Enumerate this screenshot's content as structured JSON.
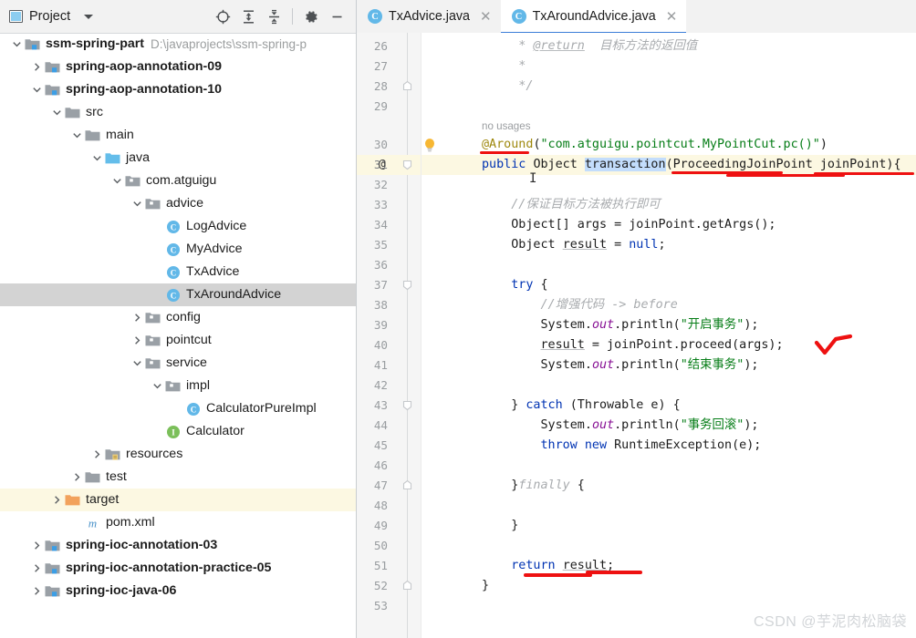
{
  "project_panel": {
    "title": "Project",
    "window_icon": "project-window-icon",
    "dropdown_icon": "chevron-down-icon",
    "toolbar_buttons": [
      {
        "name": "locate-file-icon",
        "label": "Select Opened File"
      },
      {
        "name": "expand-all-icon",
        "label": "Expand All"
      },
      {
        "name": "collapse-all-icon",
        "label": "Collapse All"
      },
      {
        "name": "settings-gear-icon",
        "label": "Options"
      },
      {
        "name": "hide-minimize-icon",
        "label": "Hide"
      }
    ],
    "tree": [
      {
        "label": "ssm-spring-part",
        "path": "D:\\javaprojects\\ssm-spring-p",
        "indent": 0,
        "arrow": "down",
        "icon": "module-folder",
        "bold": true,
        "state": "normal"
      },
      {
        "label": "spring-aop-annotation-09",
        "path": "",
        "indent": 1,
        "arrow": "right",
        "icon": "module-folder",
        "bold": true,
        "state": "normal"
      },
      {
        "label": "spring-aop-annotation-10",
        "path": "",
        "indent": 1,
        "arrow": "down",
        "icon": "module-folder",
        "bold": true,
        "state": "normal"
      },
      {
        "label": "src",
        "path": "",
        "indent": 2,
        "arrow": "down",
        "icon": "folder-gray",
        "bold": false,
        "state": "normal"
      },
      {
        "label": "main",
        "path": "",
        "indent": 3,
        "arrow": "down",
        "icon": "folder-gray",
        "bold": false,
        "state": "normal"
      },
      {
        "label": "java",
        "path": "",
        "indent": 4,
        "arrow": "down",
        "icon": "folder-source",
        "bold": false,
        "state": "normal"
      },
      {
        "label": "com.atguigu",
        "path": "",
        "indent": 5,
        "arrow": "down",
        "icon": "package",
        "bold": false,
        "state": "normal"
      },
      {
        "label": "advice",
        "path": "",
        "indent": 6,
        "arrow": "down",
        "icon": "package",
        "bold": false,
        "state": "normal"
      },
      {
        "label": "LogAdvice",
        "path": "",
        "indent": 7,
        "arrow": "none",
        "icon": "class",
        "bold": false,
        "state": "normal"
      },
      {
        "label": "MyAdvice",
        "path": "",
        "indent": 7,
        "arrow": "none",
        "icon": "class",
        "bold": false,
        "state": "normal"
      },
      {
        "label": "TxAdvice",
        "path": "",
        "indent": 7,
        "arrow": "none",
        "icon": "class",
        "bold": false,
        "state": "normal"
      },
      {
        "label": "TxAroundAdvice",
        "path": "",
        "indent": 7,
        "arrow": "none",
        "icon": "class",
        "bold": false,
        "state": "selected"
      },
      {
        "label": "config",
        "path": "",
        "indent": 6,
        "arrow": "right",
        "icon": "package",
        "bold": false,
        "state": "normal"
      },
      {
        "label": "pointcut",
        "path": "",
        "indent": 6,
        "arrow": "right",
        "icon": "package",
        "bold": false,
        "state": "normal"
      },
      {
        "label": "service",
        "path": "",
        "indent": 6,
        "arrow": "down",
        "icon": "package",
        "bold": false,
        "state": "normal"
      },
      {
        "label": "impl",
        "path": "",
        "indent": 7,
        "arrow": "down",
        "icon": "package",
        "bold": false,
        "state": "normal"
      },
      {
        "label": "CalculatorPureImpl",
        "path": "",
        "indent": 8,
        "arrow": "none",
        "icon": "class",
        "bold": false,
        "state": "normal"
      },
      {
        "label": "Calculator",
        "path": "",
        "indent": 7,
        "arrow": "none",
        "icon": "interface",
        "bold": false,
        "state": "normal"
      },
      {
        "label": "resources",
        "path": "",
        "indent": 4,
        "arrow": "right",
        "icon": "folder-resources",
        "bold": false,
        "state": "normal"
      },
      {
        "label": "test",
        "path": "",
        "indent": 3,
        "arrow": "right",
        "icon": "folder-gray",
        "bold": false,
        "state": "normal"
      },
      {
        "label": "target",
        "path": "",
        "indent": 2,
        "arrow": "right",
        "icon": "folder-target",
        "bold": false,
        "state": "highlighted"
      },
      {
        "label": "pom.xml",
        "path": "",
        "indent": 3,
        "arrow": "none",
        "icon": "maven",
        "bold": false,
        "state": "normal"
      },
      {
        "label": "spring-ioc-annotation-03",
        "path": "",
        "indent": 1,
        "arrow": "right",
        "icon": "module-folder",
        "bold": true,
        "state": "normal"
      },
      {
        "label": "spring-ioc-annotation-practice-05",
        "path": "",
        "indent": 1,
        "arrow": "right",
        "icon": "module-folder",
        "bold": true,
        "state": "normal"
      },
      {
        "label": "spring-ioc-java-06",
        "path": "",
        "indent": 1,
        "arrow": "right",
        "icon": "module-folder",
        "bold": true,
        "state": "normal"
      }
    ]
  },
  "editor": {
    "tabs": [
      {
        "label": "TxAdvice.java",
        "icon": "class",
        "active": false,
        "close_icon": "close-icon"
      },
      {
        "label": "TxAroundAdvice.java",
        "icon": "class",
        "active": true,
        "close_icon": "close-icon"
      }
    ],
    "current_line": 31,
    "gutter_marker_line": 31,
    "gutter_marker": "@",
    "inlay_hint": "no usages",
    "caret_symbol": "I",
    "line_numbers": [
      26,
      27,
      28,
      29,
      30,
      31,
      32,
      33,
      34,
      35,
      36,
      37,
      38,
      39,
      40,
      41,
      42,
      43,
      44,
      45,
      46,
      47,
      48,
      49,
      50,
      51,
      52,
      53
    ],
    "code_lines": [
      {
        "num": 26,
        "tokens": [
          {
            "t": "     * ",
            "c": "doc"
          },
          {
            "t": "@return",
            "c": "doc uline"
          },
          {
            "t": "  目标方法的返回值",
            "c": "doc"
          }
        ]
      },
      {
        "num": 27,
        "tokens": [
          {
            "t": "     *",
            "c": "doc"
          }
        ]
      },
      {
        "num": 28,
        "tokens": [
          {
            "t": "     */",
            "c": "doc"
          }
        ]
      },
      {
        "num": 29,
        "tokens": []
      },
      {
        "num": 30,
        "tokens": [
          {
            "t": "@Around",
            "c": "ann"
          },
          {
            "t": "(",
            "c": "id"
          },
          {
            "t": "\"com.atguigu.pointcut.MyPointCut.pc()\"",
            "c": "str"
          },
          {
            "t": ")",
            "c": "id"
          }
        ]
      },
      {
        "num": 31,
        "tokens": [
          {
            "t": "public ",
            "c": "kw"
          },
          {
            "t": "Object ",
            "c": "id"
          },
          {
            "t": "transaction",
            "c": "id sel-tok"
          },
          {
            "t": "(ProceedingJoinPoint joinPoint){",
            "c": "id"
          }
        ]
      },
      {
        "num": 32,
        "tokens": []
      },
      {
        "num": 33,
        "tokens": [
          {
            "t": "    //保证目标方法被执行即可",
            "c": "cmt"
          }
        ]
      },
      {
        "num": 34,
        "tokens": [
          {
            "t": "    Object[] args = joinPoint.getArgs();",
            "c": "id"
          }
        ]
      },
      {
        "num": 35,
        "tokens": [
          {
            "t": "    Object ",
            "c": "id"
          },
          {
            "t": "result",
            "c": "id uline"
          },
          {
            "t": " = ",
            "c": "id"
          },
          {
            "t": "null",
            "c": "kw"
          },
          {
            "t": ";",
            "c": "id"
          }
        ]
      },
      {
        "num": 36,
        "tokens": []
      },
      {
        "num": 37,
        "tokens": [
          {
            "t": "    ",
            "c": "id"
          },
          {
            "t": "try",
            "c": "kw"
          },
          {
            "t": " {",
            "c": "id"
          }
        ]
      },
      {
        "num": 38,
        "tokens": [
          {
            "t": "        //增强代码 -> before",
            "c": "cmt"
          }
        ]
      },
      {
        "num": 39,
        "tokens": [
          {
            "t": "        System.",
            "c": "id"
          },
          {
            "t": "out",
            "c": "fld"
          },
          {
            "t": ".println(",
            "c": "id"
          },
          {
            "t": "\"开启事务\"",
            "c": "str"
          },
          {
            "t": ");",
            "c": "id"
          }
        ]
      },
      {
        "num": 40,
        "tokens": [
          {
            "t": "        ",
            "c": "id"
          },
          {
            "t": "result",
            "c": "id uline"
          },
          {
            "t": " = joinPoint.proceed(args);",
            "c": "id"
          }
        ]
      },
      {
        "num": 41,
        "tokens": [
          {
            "t": "        System.",
            "c": "id"
          },
          {
            "t": "out",
            "c": "fld"
          },
          {
            "t": ".println(",
            "c": "id"
          },
          {
            "t": "\"结束事务\"",
            "c": "str"
          },
          {
            "t": ");",
            "c": "id"
          }
        ]
      },
      {
        "num": 42,
        "tokens": []
      },
      {
        "num": 43,
        "tokens": [
          {
            "t": "    } ",
            "c": "id"
          },
          {
            "t": "catch",
            "c": "kw"
          },
          {
            "t": " (Throwable e) {",
            "c": "id"
          }
        ]
      },
      {
        "num": 44,
        "tokens": [
          {
            "t": "        System.",
            "c": "id"
          },
          {
            "t": "out",
            "c": "fld"
          },
          {
            "t": ".println(",
            "c": "id"
          },
          {
            "t": "\"事务回滚\"",
            "c": "str"
          },
          {
            "t": ");",
            "c": "id"
          }
        ]
      },
      {
        "num": 45,
        "tokens": [
          {
            "t": "        ",
            "c": "id"
          },
          {
            "t": "throw new ",
            "c": "kw"
          },
          {
            "t": "RuntimeException(e);",
            "c": "id"
          }
        ]
      },
      {
        "num": 46,
        "tokens": []
      },
      {
        "num": 47,
        "tokens": [
          {
            "t": "    }",
            "c": "id"
          },
          {
            "t": "finally",
            "c": "cmt"
          },
          {
            "t": " {",
            "c": "id"
          }
        ]
      },
      {
        "num": 48,
        "tokens": []
      },
      {
        "num": 49,
        "tokens": [
          {
            "t": "    }",
            "c": "id"
          }
        ]
      },
      {
        "num": 50,
        "tokens": []
      },
      {
        "num": 51,
        "tokens": [
          {
            "t": "    ",
            "c": "id"
          },
          {
            "t": "return ",
            "c": "kw"
          },
          {
            "t": "result",
            "c": "id uline"
          },
          {
            "t": ";",
            "c": "id"
          }
        ]
      },
      {
        "num": 52,
        "tokens": [
          {
            "t": "}",
            "c": "id"
          }
        ]
      },
      {
        "num": 53,
        "tokens": []
      }
    ]
  },
  "annotations": {
    "ink_color": "#ee1111",
    "marks": [
      "underline-around",
      "underline-proceedingjoinpoint",
      "check-proceed",
      "underline-return-result"
    ]
  },
  "watermark": "CSDN @芋泥肉松脑袋",
  "colors": {
    "accent_tab": "#3b7dd8",
    "keyword": "#0033b3",
    "string": "#067d17",
    "comment": "#a8abae",
    "annotation": "#9e880d",
    "field": "#871094",
    "selection": "#c3ddfc",
    "current_line": "#fcf8e2",
    "tree_selected": "#d3d3d3",
    "ink": "#ee1111"
  }
}
